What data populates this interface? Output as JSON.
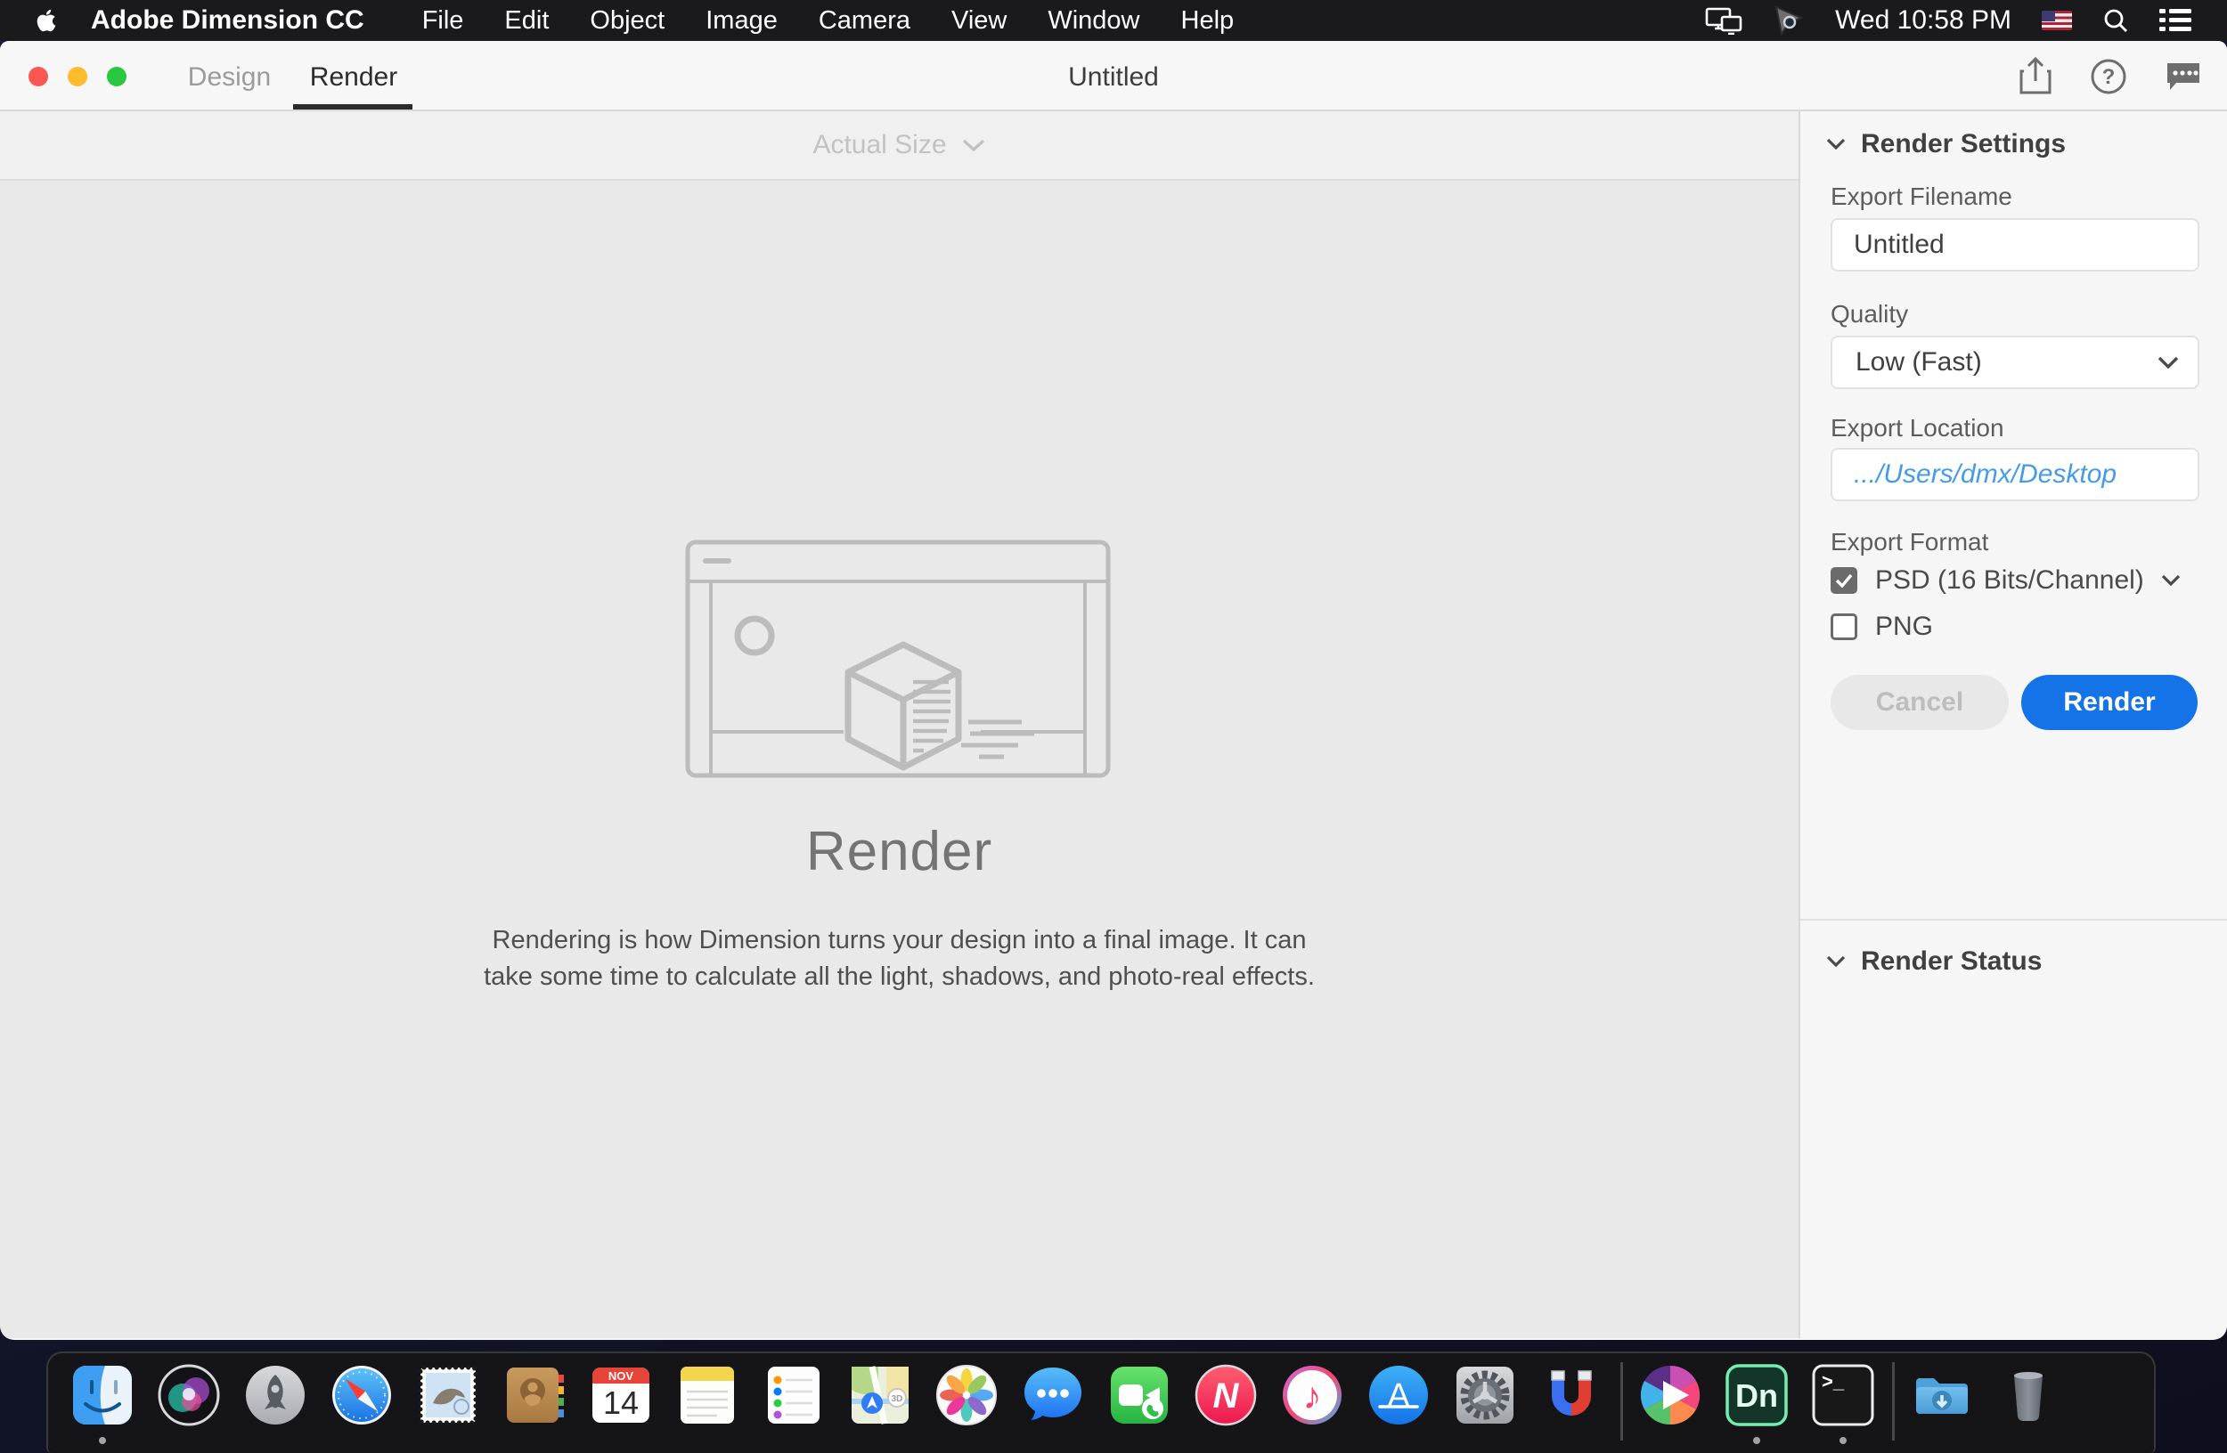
{
  "menubar": {
    "app_name": "Adobe Dimension CC",
    "items": [
      "File",
      "Edit",
      "Object",
      "Image",
      "Camera",
      "View",
      "Window",
      "Help"
    ],
    "clock": "Wed 10:58 PM"
  },
  "titlebar": {
    "tabs": [
      {
        "label": "Design",
        "active": false
      },
      {
        "label": "Render",
        "active": true
      }
    ],
    "document_title": "Untitled"
  },
  "toolbar": {
    "zoom_level": "Actual Size"
  },
  "canvas": {
    "heading": "Render",
    "description_line1": "Rendering is how Dimension turns your design into a final image. It can",
    "description_line2": "take some time to calculate all the light, shadows, and photo-real effects."
  },
  "panel": {
    "settings_title": "Render Settings",
    "export_filename_label": "Export Filename",
    "export_filename_value": "Untitled",
    "quality_label": "Quality",
    "quality_value": "Low (Fast)",
    "export_location_label": "Export Location",
    "export_location_value": ".../Users/dmx/Desktop",
    "export_format_label": "Export Format",
    "formats": [
      {
        "label": "PSD (16 Bits/Channel)",
        "checked": true
      },
      {
        "label": "PNG",
        "checked": false
      }
    ],
    "cancel_label": "Cancel",
    "render_label": "Render",
    "status_title": "Render Status"
  },
  "dock": {
    "calendar_month": "NOV",
    "calendar_day": "14",
    "maps_3d": "3D",
    "news_n": "N",
    "itunes_note": "♪",
    "appstore_a": "A",
    "dimension_label": "Dn",
    "terminal_prompt": ">_"
  },
  "colors": {
    "accent_blue": "#1473e6",
    "link_blue": "#459bea"
  }
}
